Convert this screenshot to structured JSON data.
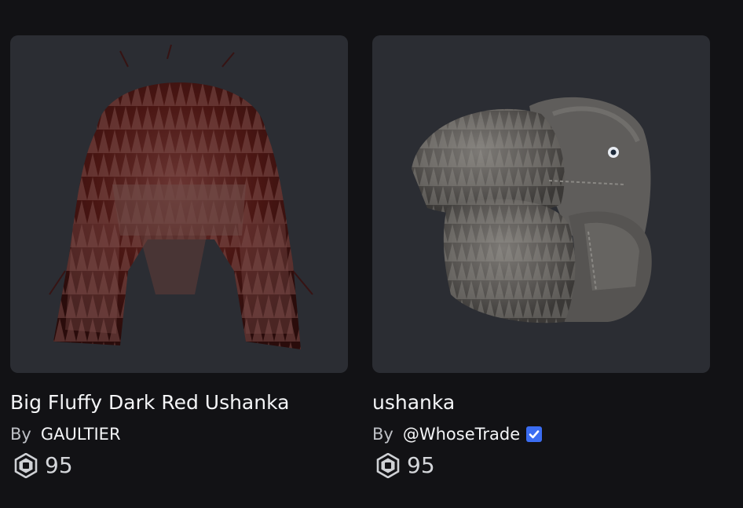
{
  "items": [
    {
      "name": "Big Fluffy Dark Red Ushanka",
      "by_label": "By",
      "creator": "GAULTIER",
      "verified": false,
      "price": "95",
      "thumbnail_icon": "dark-red-fur-ushanka",
      "colors": {
        "fur": "#5a1a18",
        "fur_light": "#8a3a36"
      }
    },
    {
      "name": "ushanka",
      "by_label": "By",
      "creator": "@WhoseTrade",
      "verified": true,
      "price": "95",
      "thumbnail_icon": "grey-fur-ushanka",
      "colors": {
        "fur": "#4a4846",
        "fur_light": "#7a7774",
        "verified": "#3b6df2"
      }
    }
  ],
  "colors": {
    "page_background": "#121215",
    "card_background": "#2b2d33",
    "text_primary": "#f4f5f7",
    "text_secondary": "#bfc1c6"
  }
}
